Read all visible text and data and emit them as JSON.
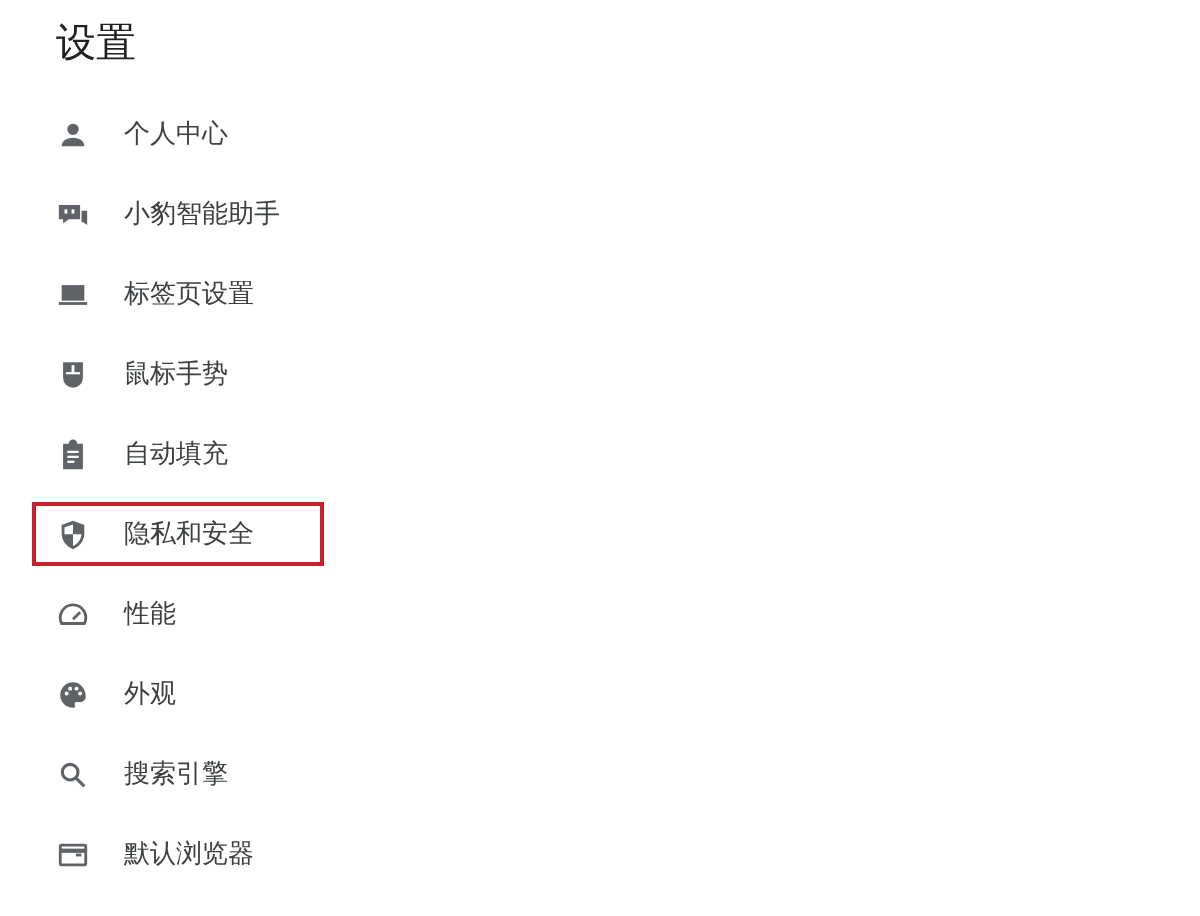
{
  "title": "设置",
  "items": [
    {
      "label": "个人中心",
      "kind": "person",
      "highlighted": false
    },
    {
      "label": "小豹智能助手",
      "kind": "assistant",
      "highlighted": false
    },
    {
      "label": "标签页设置",
      "kind": "laptop",
      "highlighted": false
    },
    {
      "label": "鼠标手势",
      "kind": "mouse",
      "highlighted": false
    },
    {
      "label": "自动填充",
      "kind": "clipboard",
      "highlighted": false
    },
    {
      "label": "隐私和安全",
      "kind": "shield",
      "highlighted": true
    },
    {
      "label": "性能",
      "kind": "gauge",
      "highlighted": false
    },
    {
      "label": "外观",
      "kind": "palette",
      "highlighted": false
    },
    {
      "label": "搜索引擎",
      "kind": "search",
      "highlighted": false
    },
    {
      "label": "默认浏览器",
      "kind": "browser",
      "highlighted": false
    }
  ]
}
